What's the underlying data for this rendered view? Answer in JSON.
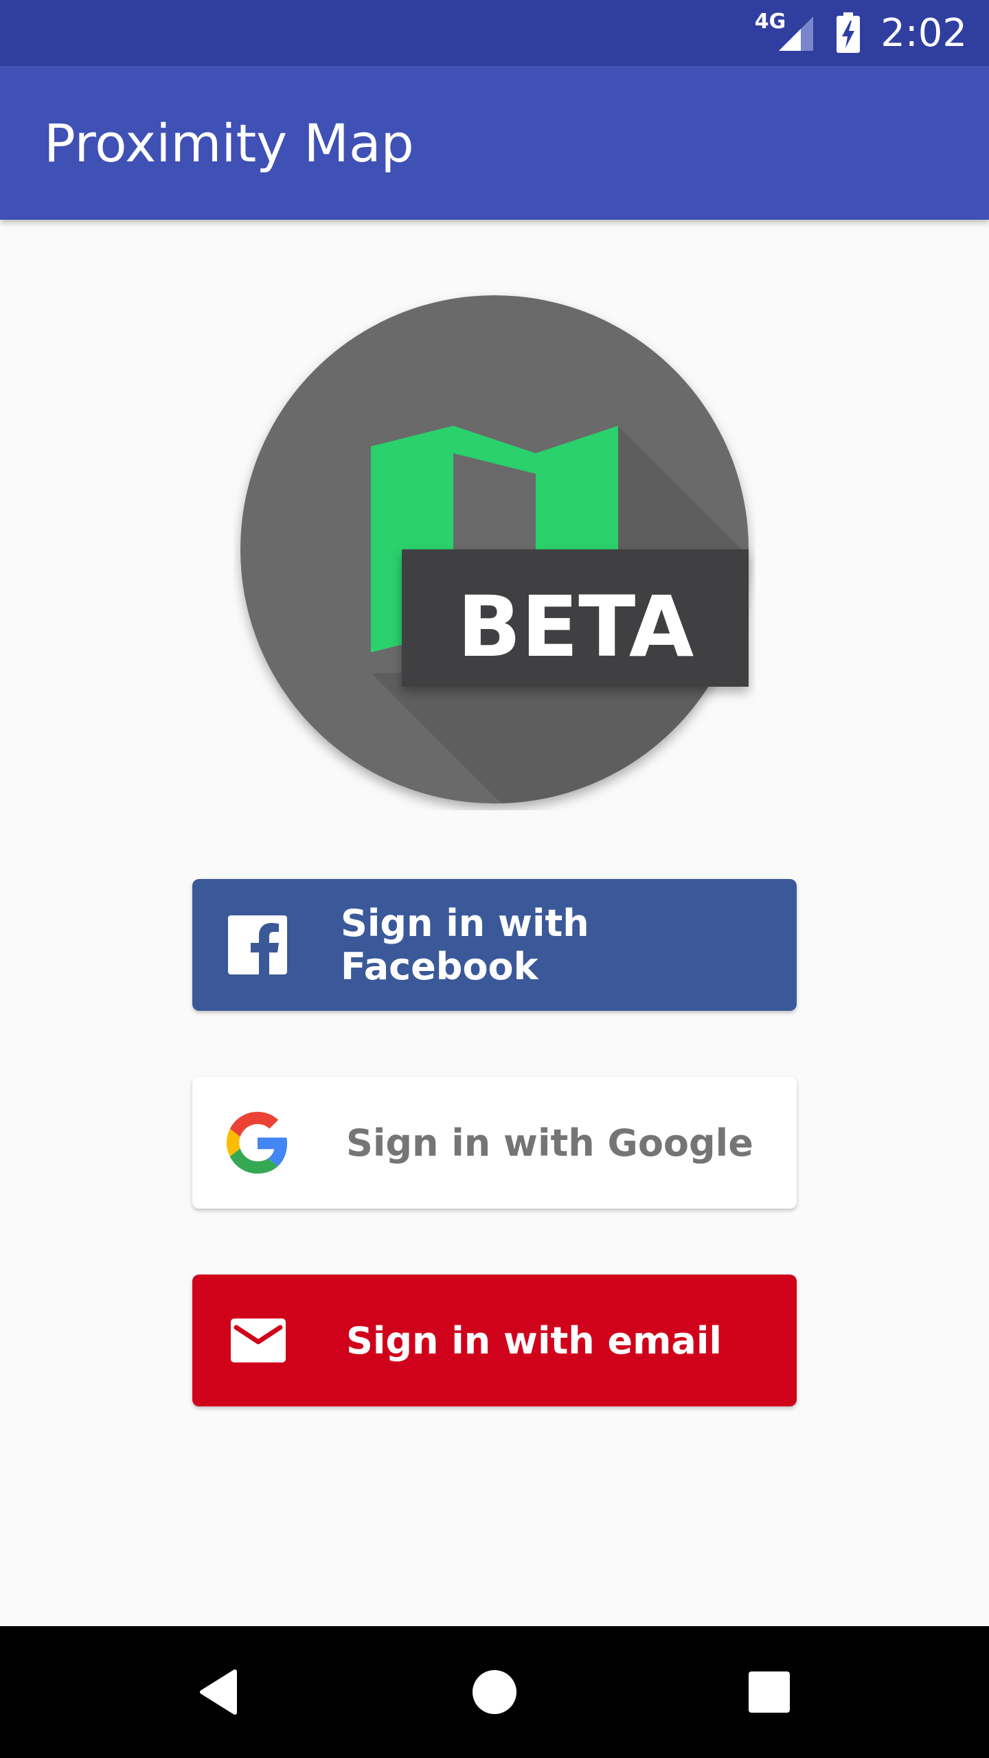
{
  "status_bar": {
    "network": "4G",
    "time": "2:02",
    "icons": [
      "cellular-signal-icon",
      "battery-charging-icon"
    ]
  },
  "app_bar": {
    "title": "Proximity Map"
  },
  "logo": {
    "badge_text": "BETA",
    "colors": {
      "circle": "#6b6b6b",
      "mark": "#2ad16c",
      "badge": "#404042",
      "shadow": "#5e5e5e"
    }
  },
  "sign_in": {
    "facebook": {
      "label": "Sign in with Facebook",
      "icon": "facebook-icon",
      "color": "#3b5998"
    },
    "google": {
      "label": "Sign in with Google",
      "icon": "google-icon",
      "color": "#ffffff"
    },
    "email": {
      "label": "Sign in with email",
      "icon": "mail-icon",
      "color": "#d0021b"
    }
  },
  "nav_bar": {
    "buttons": [
      "back-icon",
      "home-icon",
      "recents-icon"
    ]
  }
}
